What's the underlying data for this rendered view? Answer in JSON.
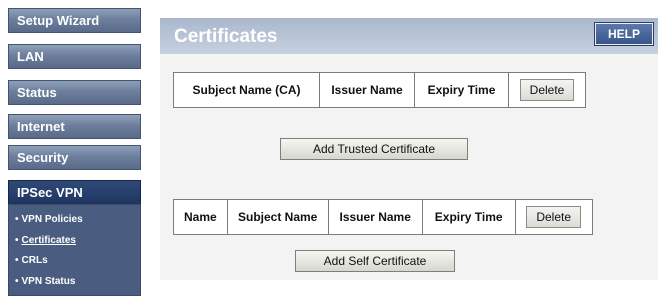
{
  "sidebar": {
    "items": [
      {
        "label": "Setup Wizard"
      },
      {
        "label": "LAN"
      },
      {
        "label": "Status"
      },
      {
        "label": "Internet"
      },
      {
        "label": "Security"
      },
      {
        "label": "IPSec VPN"
      }
    ],
    "sub_items": [
      {
        "label": "VPN Policies"
      },
      {
        "label": "Certificates"
      },
      {
        "label": "CRLs"
      },
      {
        "label": "VPN Status"
      }
    ],
    "bullet": "•"
  },
  "main": {
    "title": "Certificates",
    "help_label": "HELP",
    "trusted_table": {
      "headers": [
        "Subject Name (CA)",
        "Issuer Name",
        "Expiry Time"
      ],
      "delete_label": "Delete"
    },
    "add_trusted_label": "Add Trusted Certificate",
    "self_table": {
      "headers": [
        "Name",
        "Subject Name",
        "Issuer Name",
        "Expiry Time"
      ],
      "delete_label": "Delete"
    },
    "add_self_label": "Add Self Certificate"
  },
  "colors": {
    "nav_button": "#6d7f9d",
    "nav_active": "#1f3560",
    "title_bar": "#aab7cd",
    "help_button": "#3b5688"
  }
}
